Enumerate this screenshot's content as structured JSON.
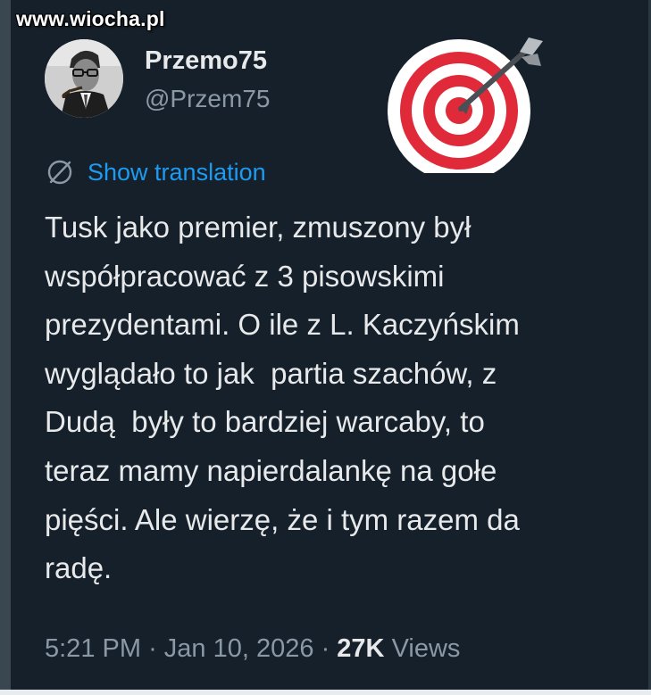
{
  "watermark": "www.wiocha.pl",
  "author": {
    "display_name": "Przemo75",
    "handle": "@Przem75"
  },
  "icons": {
    "avatar": "profile-photo",
    "emoji": "direct-hit-target-icon",
    "translate": "globe-slash-icon"
  },
  "translation_link": "Show translation",
  "tweet_text": "Tusk jako premier, zmuszony był\nwspółpracować z 3 pisowskimi\nprezydentami. O ile z L. Kaczyńskim\nwyglądało to jak  partia szachów, z\nDudą  były to bardziej warcaby, to\nteraz mamy napierdalankę na gołe\npięści. Ale wierzę, że i tym razem da\nradę.",
  "meta": {
    "time": "5:21 PM",
    "separator": "·",
    "date": "Jan 10, 2026",
    "views_count": "27K",
    "views_label": "Views"
  },
  "colors": {
    "background": "#15202b",
    "primary_text": "#e7e9ea",
    "secondary_text": "#8b98a5",
    "link": "#1d9bf0",
    "target_red": "#e02a3a"
  }
}
